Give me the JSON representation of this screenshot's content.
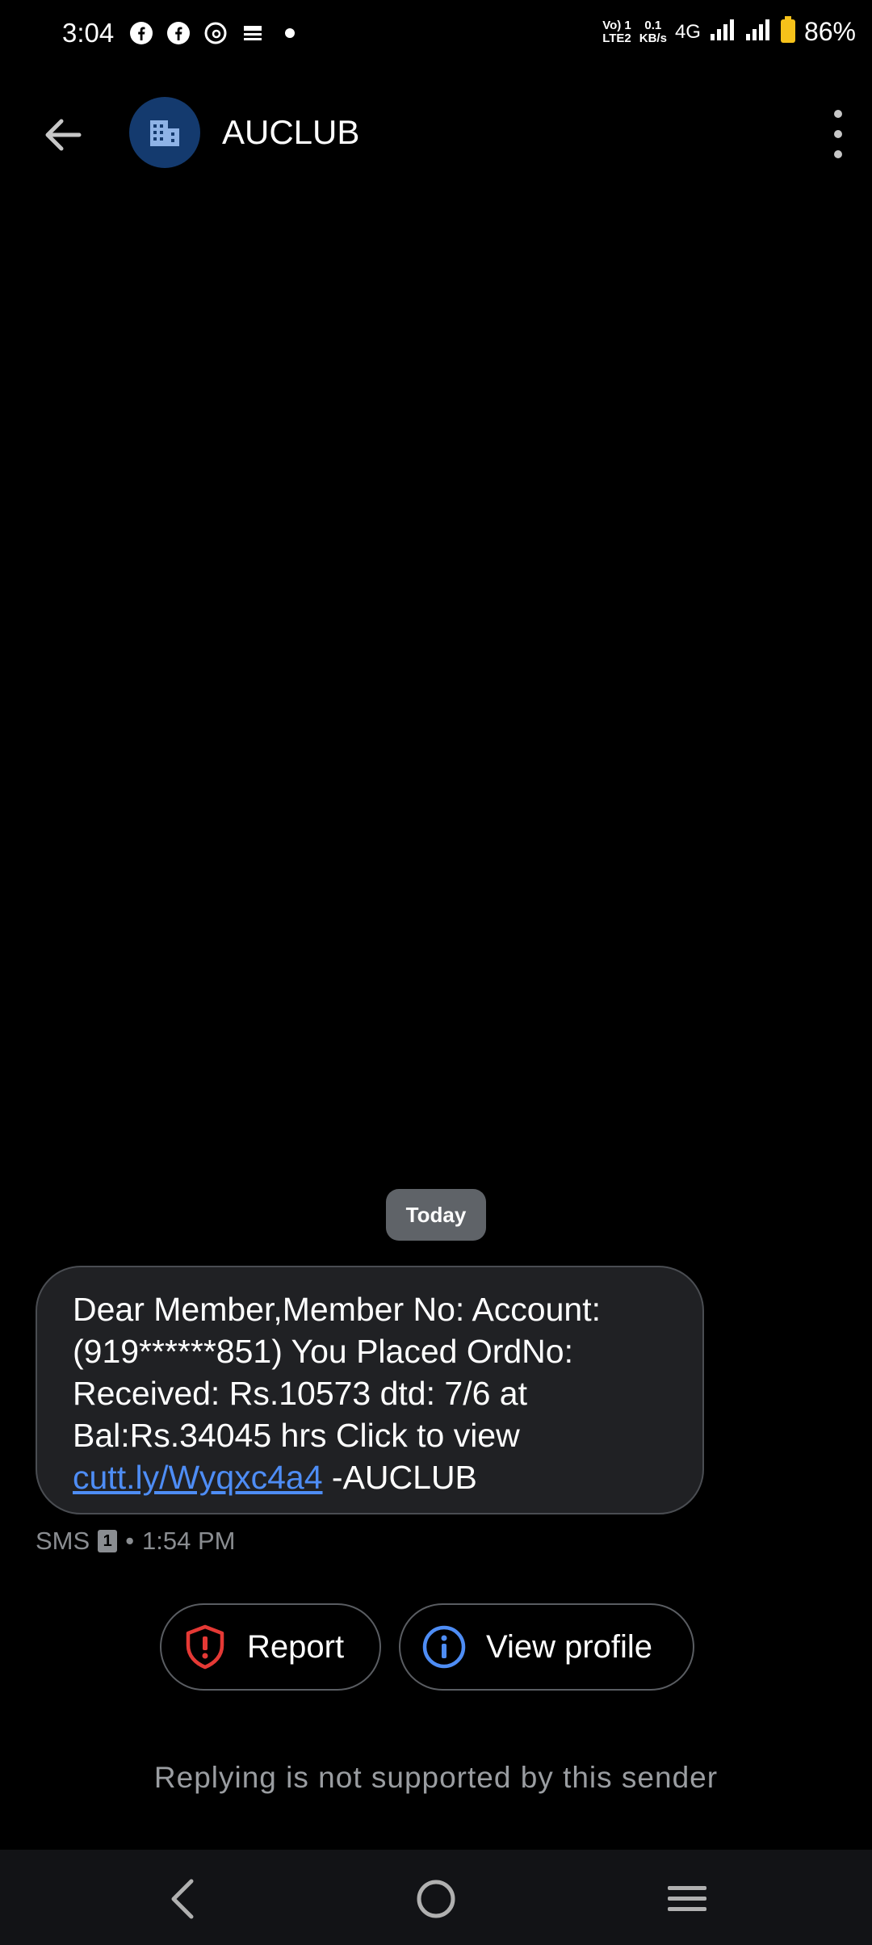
{
  "status_bar": {
    "time": "3:04",
    "volte_top": "Vo) 1",
    "volte_bottom": "LTE2",
    "speed_top": "0.1",
    "speed_bottom": "KB/s",
    "network": "4G",
    "battery_percent": "86%",
    "icons": [
      "facebook-icon",
      "facebook-icon",
      "threads-icon",
      "app-icon",
      "dot-icon",
      "signal-icon",
      "signal-icon",
      "battery-icon"
    ]
  },
  "header": {
    "title": "AUCLUB",
    "avatar_icon": "building-icon"
  },
  "conversation": {
    "date_chip": "Today",
    "message": {
      "text_before_link": "Dear Member,Member No: Account: (919******851) You Placed OrdNo: Received: Rs.10573 dtd: 7/6 at Bal:Rs.34045 hrs Click to view ",
      "link_text": "cutt.ly/Wyqxc4a4",
      "text_after_link": " -AUCLUB"
    },
    "meta": {
      "type": "SMS",
      "sim": "1",
      "separator": "•",
      "time": "1:54 PM"
    }
  },
  "actions": {
    "report_label": "Report",
    "view_profile_label": "View profile"
  },
  "footer_note": "Replying is not supported by this sender",
  "colors": {
    "background": "#000000",
    "bubble": "#202124",
    "link": "#4e8df5",
    "report_icon": "#e53935",
    "info_icon": "#4e8df5",
    "avatar_bg": "#143a6e"
  }
}
